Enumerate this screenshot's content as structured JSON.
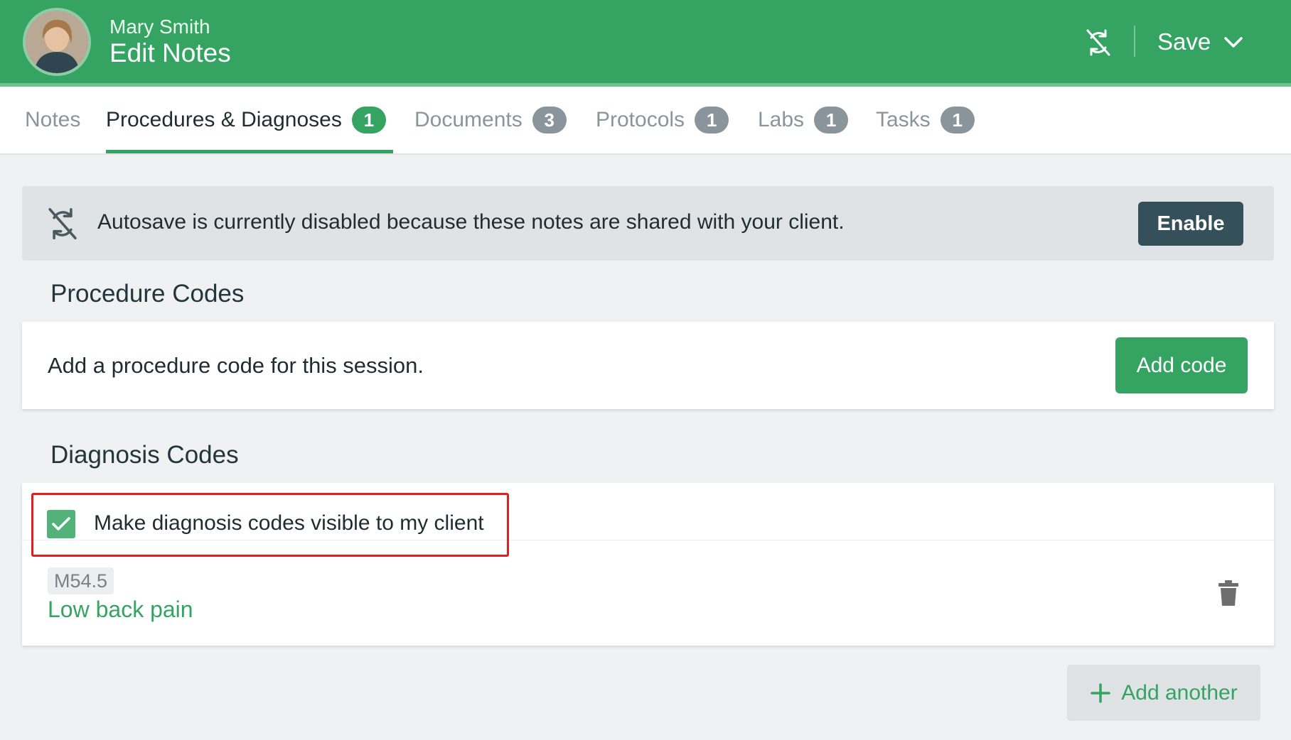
{
  "header": {
    "user_name": "Mary Smith",
    "title": "Edit Notes",
    "save_label": "Save",
    "icons": [
      "avatar",
      "sync-off-icon",
      "chevron-down-icon"
    ]
  },
  "tabs": [
    {
      "label": "Notes",
      "count": null,
      "active": false
    },
    {
      "label": "Procedures & Diagnoses",
      "count": "1",
      "active": true
    },
    {
      "label": "Documents",
      "count": "3",
      "active": false
    },
    {
      "label": "Protocols",
      "count": "1",
      "active": false
    },
    {
      "label": "Labs",
      "count": "1",
      "active": false
    },
    {
      "label": "Tasks",
      "count": "1",
      "active": false
    }
  ],
  "banner": {
    "text": "Autosave is currently disabled because these notes are shared with your client.",
    "button_label": "Enable"
  },
  "procedure": {
    "section_title": "Procedure Codes",
    "prompt": "Add a procedure code for this session.",
    "add_button": "Add code"
  },
  "diagnosis": {
    "section_title": "Diagnosis Codes",
    "visible_label": "Make diagnosis codes visible to my client",
    "visible_checked": true,
    "codes": [
      {
        "code": "M54.5",
        "description": "Low back pain"
      }
    ],
    "add_another": "Add another"
  },
  "colors": {
    "brand_green": "#35a463",
    "dark_button": "#35505a",
    "badge_gray": "#8a959b",
    "highlight_red": "#e02020"
  }
}
